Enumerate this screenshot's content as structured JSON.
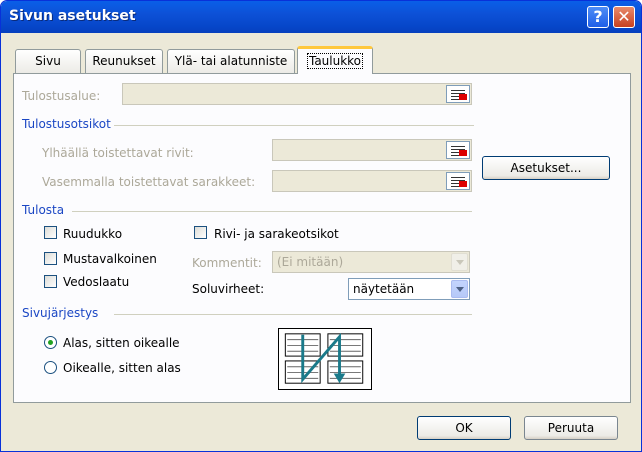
{
  "window": {
    "title": "Sivun asetukset",
    "help_label": "?",
    "close_label": "✕"
  },
  "tabs": [
    {
      "label": "Sivu"
    },
    {
      "label": "Reunukset"
    },
    {
      "label": "Ylä- tai alatunniste"
    },
    {
      "label": "Taulukko",
      "active": true
    }
  ],
  "print_area": {
    "label": "Tulostusalue:",
    "value": ""
  },
  "print_titles": {
    "heading": "Tulostusotsikot",
    "rows_label": "Ylhäällä toistettavat rivit:",
    "cols_label": "Vasemmalla toistettavat sarakkeet:",
    "settings_button": "Asetukset..."
  },
  "print": {
    "heading": "Tulosta",
    "gridlines": {
      "label": "Ruudukko",
      "checked": false
    },
    "black_white": {
      "label": "Mustavalkoinen",
      "checked": false
    },
    "draft": {
      "label": "Vedoslaatu",
      "checked": false
    },
    "headings": {
      "label": "Rivi- ja sarakeotsikot",
      "checked": false
    },
    "comments_label": "Kommentit:",
    "comments_value": "(Ei mitään)",
    "errors_label": "Soluvirheet:",
    "errors_value": "näytetään"
  },
  "page_order": {
    "heading": "Sivujärjestys",
    "down_then_over": "Alas, sitten oikealle",
    "over_then_down": "Oikealle, sitten alas",
    "selected": "down_then_over"
  },
  "buttons": {
    "ok": "OK",
    "cancel": "Peruuta"
  },
  "icons": [
    "help-icon",
    "close-icon",
    "range-select-icon",
    "page-order-icon"
  ]
}
